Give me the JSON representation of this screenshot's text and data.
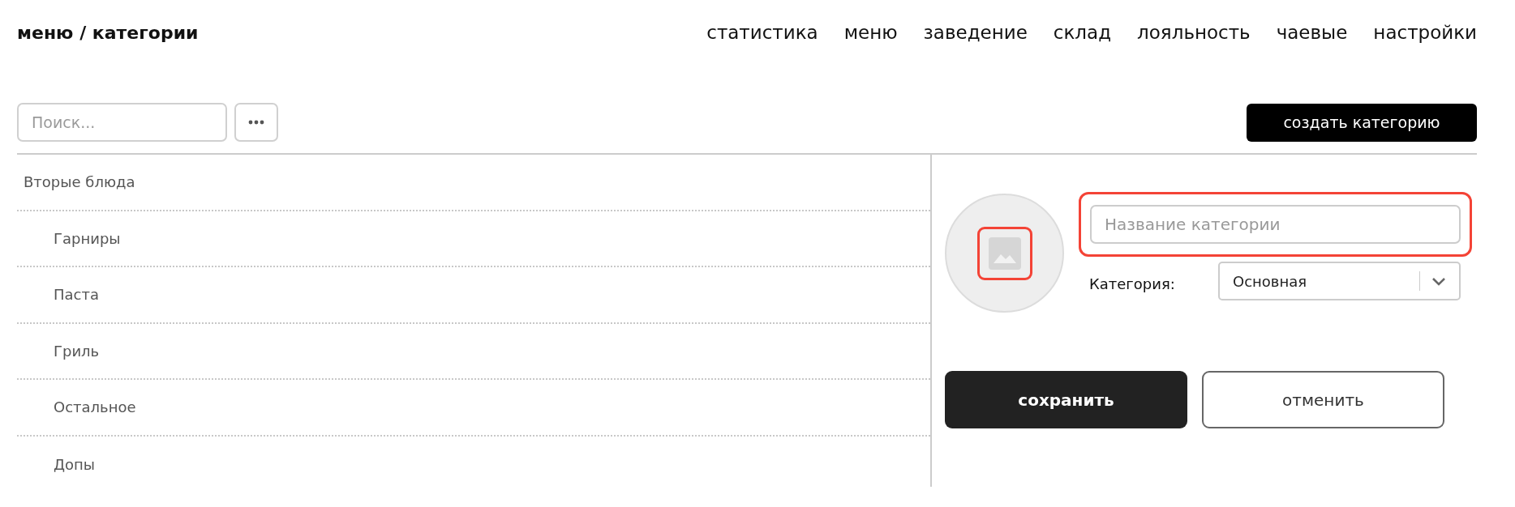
{
  "header": {
    "breadcrumb": "меню / категории",
    "nav": [
      {
        "label": "статистика"
      },
      {
        "label": "меню"
      },
      {
        "label": "заведение"
      },
      {
        "label": "склад"
      },
      {
        "label": "лояльность"
      },
      {
        "label": "чаевые"
      },
      {
        "label": "настройки"
      }
    ]
  },
  "toolbar": {
    "search": {
      "placeholder": "Поиск..."
    },
    "create_button": "создать категорию"
  },
  "categories": [
    {
      "label": "Вторые блюда",
      "children": [
        {
          "label": "Гарниры"
        },
        {
          "label": "Паста"
        },
        {
          "label": "Гриль"
        },
        {
          "label": "Остальное"
        },
        {
          "label": "Допы"
        }
      ]
    }
  ],
  "form": {
    "image": {
      "error": true
    },
    "name_field": {
      "placeholder": "Название категории",
      "error": true
    },
    "category_label": "Категория:",
    "category_select": {
      "value": "Основная"
    },
    "save_button": "сохранить",
    "cancel_button": "отменить"
  }
}
